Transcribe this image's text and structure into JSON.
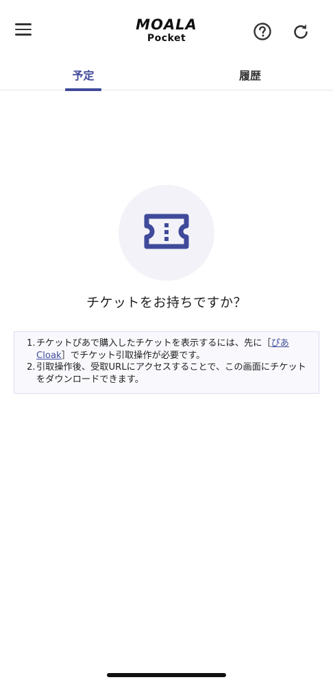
{
  "app": {
    "logo_main": "MOALA",
    "logo_sub": "Pocket"
  },
  "header": {
    "menu_icon": "hamburger-menu-icon",
    "help_icon": "help-circle-icon",
    "refresh_icon": "refresh-icon"
  },
  "tabs": [
    {
      "label": "予定",
      "active": true
    },
    {
      "label": "履歴",
      "active": false
    }
  ],
  "empty_state": {
    "icon": "ticket-icon",
    "question": "チケットをお持ちですか？"
  },
  "info": {
    "item1_num": "1.",
    "item1_pre": "チケットぴあで購入したチケットを表示するには、先に［",
    "item1_link": "ぴあCloak",
    "item1_post": "］でチケット引取操作が必要です。",
    "item2_num": "2.",
    "item2_text": "引取操作後、受取URLにアクセスすることで、この画面にチケットをダウンロードできます。"
  },
  "colors": {
    "accent": "#3f4a9a",
    "circle_bg": "#f2f2f8",
    "info_border": "#d9dcf0"
  }
}
